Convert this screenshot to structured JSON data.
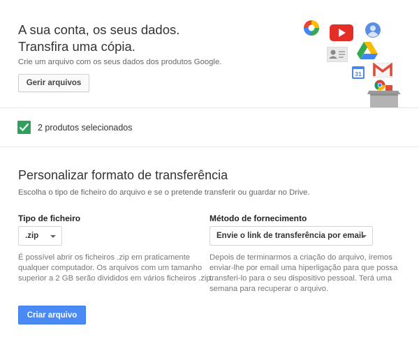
{
  "hero": {
    "title_line1": "A sua conta, os seus dados.",
    "title_line2": "Transfira uma cópia.",
    "subtitle": "Crie um arquivo com os seus dados dos produtos Google.",
    "manage_button": "Gerir arquivos",
    "product_icons": [
      "picasa-icon",
      "youtube-icon",
      "profile-icon",
      "contacts-icon",
      "drive-icon",
      "calendar-icon",
      "gmail-icon",
      "chrome-icon",
      "archive-box-icon"
    ],
    "calendar_day": "31"
  },
  "selection": {
    "checked": true,
    "label": "2 produtos selecionados"
  },
  "customize": {
    "title": "Personalizar formato de transferência",
    "description": "Escolha o tipo de ficheiro do arquivo e se o pretende transferir ou guardar no Drive.",
    "file_type": {
      "label": "Tipo de ficheiro",
      "value": ".zip",
      "note_line1": "É possível abrir os ficheiros .zip em praticamente",
      "note_line2": "qualquer computador. Os arquivos com um tamanho",
      "note_line3": "superior a 2 GB serão divididos em vários ficheiros .zip."
    },
    "delivery": {
      "label": "Método de fornecimento",
      "value": "Envie o link de transferência por email",
      "note_line1": "Depois de terminarmos a criação do arquivo, iremos",
      "note_line2": "enviar-lhe por email uma hiperligação para que possa",
      "note_line3": "transferi-lo para o seu dispositivo pessoal. Terá uma",
      "note_line4": "semana para recuperar o arquivo."
    },
    "create_button": "Criar arquivo"
  },
  "colors": {
    "accent_blue": "#4a8af4",
    "check_green": "#31a05f",
    "divider": "#e5e5e5"
  }
}
